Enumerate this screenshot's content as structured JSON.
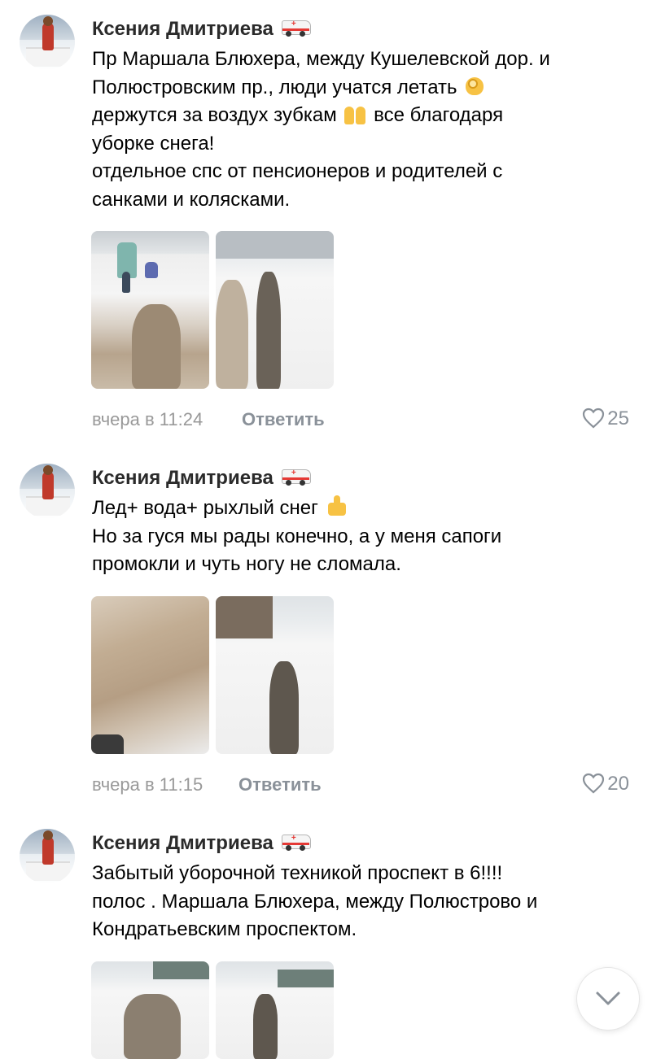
{
  "comments": [
    {
      "author": "Ксения Дмитриева",
      "badge_icon": "ambulance-icon",
      "lines": [
        "Пр Маршала Блюхера, между Кушелевской дор. и",
        "Полюстровским пр., люди учатся летать",
        "держутся за воздух зубкам",
        "все благодаря",
        "уборке снега!",
        "отдельное спс от пенсионеров и родителей с",
        "санками и колясками."
      ],
      "time": "вчера в 11:24",
      "reply": "Ответить",
      "likes": "25"
    },
    {
      "author": "Ксения Дмитриева",
      "badge_icon": "ambulance-icon",
      "lines": [
        "Лед+ вода+ рыхлый снег",
        "Но за гуся мы рады конечно, а у меня сапоги",
        "промокли и чуть ногу не сломала."
      ],
      "time": "вчера в 11:15",
      "reply": "Ответить",
      "likes": "20"
    },
    {
      "author": "Ксения Дмитриева",
      "badge_icon": "ambulance-icon",
      "lines": [
        "Забытый уборочной техникой  проспект в 6!!!!",
        "полос . Маршала  Блюхера, между Полюстрово и",
        "Кондратьевским проспектом."
      ]
    }
  ],
  "colors": {
    "meta": "#999999",
    "action": "#8a9199"
  },
  "icons": {
    "like": "heart-icon",
    "scroll": "chevron-down-icon"
  }
}
